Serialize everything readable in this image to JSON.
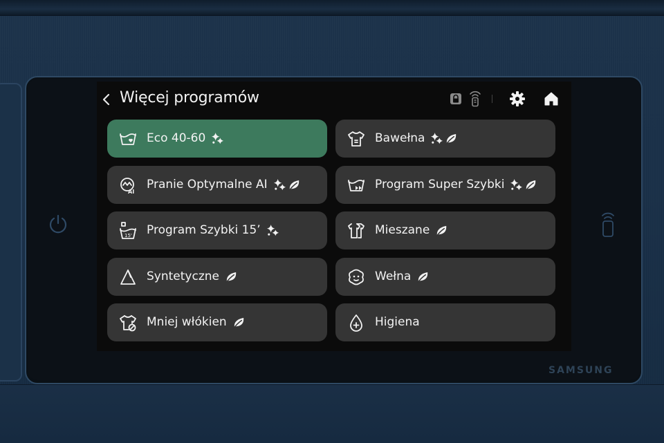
{
  "brand": "SAMSUNG",
  "header": {
    "title": "Więcej programów",
    "back_icon": "chevron-left-icon",
    "status_icons": [
      "lock-icon",
      "remote-control-icon"
    ],
    "actions": [
      "settings-gear-icon",
      "home-icon"
    ]
  },
  "programs": [
    {
      "label": "Eco 40-60",
      "icon": "tub-heart-icon",
      "badges": [
        "sparkle-icon"
      ],
      "selected": true
    },
    {
      "label": "Bawełna",
      "icon": "tshirt-icon",
      "badges": [
        "sparkle-icon",
        "leaf-icon"
      ],
      "selected": false
    },
    {
      "label": "Pranie Optymalne AI",
      "icon": "ai-wash-icon",
      "badges": [
        "sparkle-icon",
        "leaf-icon"
      ],
      "selected": false
    },
    {
      "label": "Program Super Szybki",
      "icon": "tub-fast-forward-icon",
      "badges": [
        "sparkle-icon",
        "leaf-icon"
      ],
      "selected": false
    },
    {
      "label": "Program Szybki 15’",
      "icon": "tub-15-icon",
      "badges": [
        "sparkle-icon"
      ],
      "selected": false
    },
    {
      "label": "Mieszane",
      "icon": "mixed-clothes-icon",
      "badges": [
        "leaf-icon"
      ],
      "selected": false
    },
    {
      "label": "Syntetyczne",
      "icon": "synthetic-icon",
      "badges": [
        "leaf-icon"
      ],
      "selected": false
    },
    {
      "label": "Wełna",
      "icon": "sheep-icon",
      "badges": [
        "leaf-icon"
      ],
      "selected": false
    },
    {
      "label": "Mniej włókien",
      "icon": "lint-shirt-icon",
      "badges": [
        "leaf-icon"
      ],
      "selected": false
    },
    {
      "label": "Higiena",
      "icon": "hygiene-drop-icon",
      "badges": [],
      "selected": false
    }
  ],
  "colors": {
    "selected_tile": "#3d7a5d",
    "tile": "#353535",
    "screen_bg": "#0b0b0b",
    "body_panel": "#1a3048"
  }
}
